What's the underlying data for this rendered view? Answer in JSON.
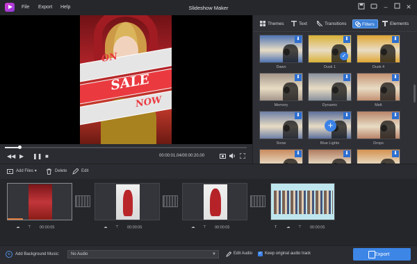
{
  "app": {
    "title": "Slideshow Maker"
  },
  "menu": {
    "file": "File",
    "export": "Export",
    "help": "Help"
  },
  "preview": {
    "poster_words": [
      "ON",
      "SALE",
      "NOW"
    ],
    "timecode": "00:00:01.04/00:00:20.00",
    "progress_fraction": 0.06
  },
  "tabs": [
    {
      "label": "Themes",
      "icon": "themes-grid-icon"
    },
    {
      "label": "Text",
      "icon": "text-T-icon"
    },
    {
      "label": "Transitions",
      "icon": "transitions-icon"
    },
    {
      "label": "Filters",
      "icon": "filters-icon",
      "active": true
    },
    {
      "label": "Elements",
      "icon": "elements-icon"
    }
  ],
  "filters": [
    {
      "name": "Dawn",
      "tone": "#4f74b4"
    },
    {
      "name": "Dusk 1",
      "tone": "#d9b136",
      "selected": true
    },
    {
      "name": "Dusk 4",
      "tone": "#e0a633"
    },
    {
      "name": "Memory",
      "tone": "#a49689"
    },
    {
      "name": "Dynamic",
      "tone": "#8a919d"
    },
    {
      "name": "Melt",
      "tone": "#c39172"
    },
    {
      "name": "Snow",
      "tone": "#6d7fa6"
    },
    {
      "name": "Blue Lights",
      "tone": "#5c6f9c",
      "hover": true
    },
    {
      "name": "Drops",
      "tone": "#b8856a"
    },
    {
      "name": "",
      "tone": "#c98a5c"
    },
    {
      "name": "",
      "tone": "#b07a5e"
    },
    {
      "name": "",
      "tone": "#d4924f"
    }
  ],
  "toolbar": {
    "add_files": "Add Files",
    "delete": "Delete",
    "edit": "Edit"
  },
  "clips": [
    {
      "duration": "00:00:05",
      "selected": true
    },
    {
      "duration": "00:00:05"
    },
    {
      "duration": "00:00:05"
    },
    {
      "duration": "00:00:05",
      "text_icon": true
    }
  ],
  "bottom": {
    "add_bgm": "Add Background Music:",
    "audio_select": "No Audio",
    "edit_audio": "Edit Audio",
    "keep_audio": "Keep original audio track",
    "export": "Export"
  },
  "colors": {
    "accent": "#3d86e6",
    "background": "#2b2c31"
  }
}
